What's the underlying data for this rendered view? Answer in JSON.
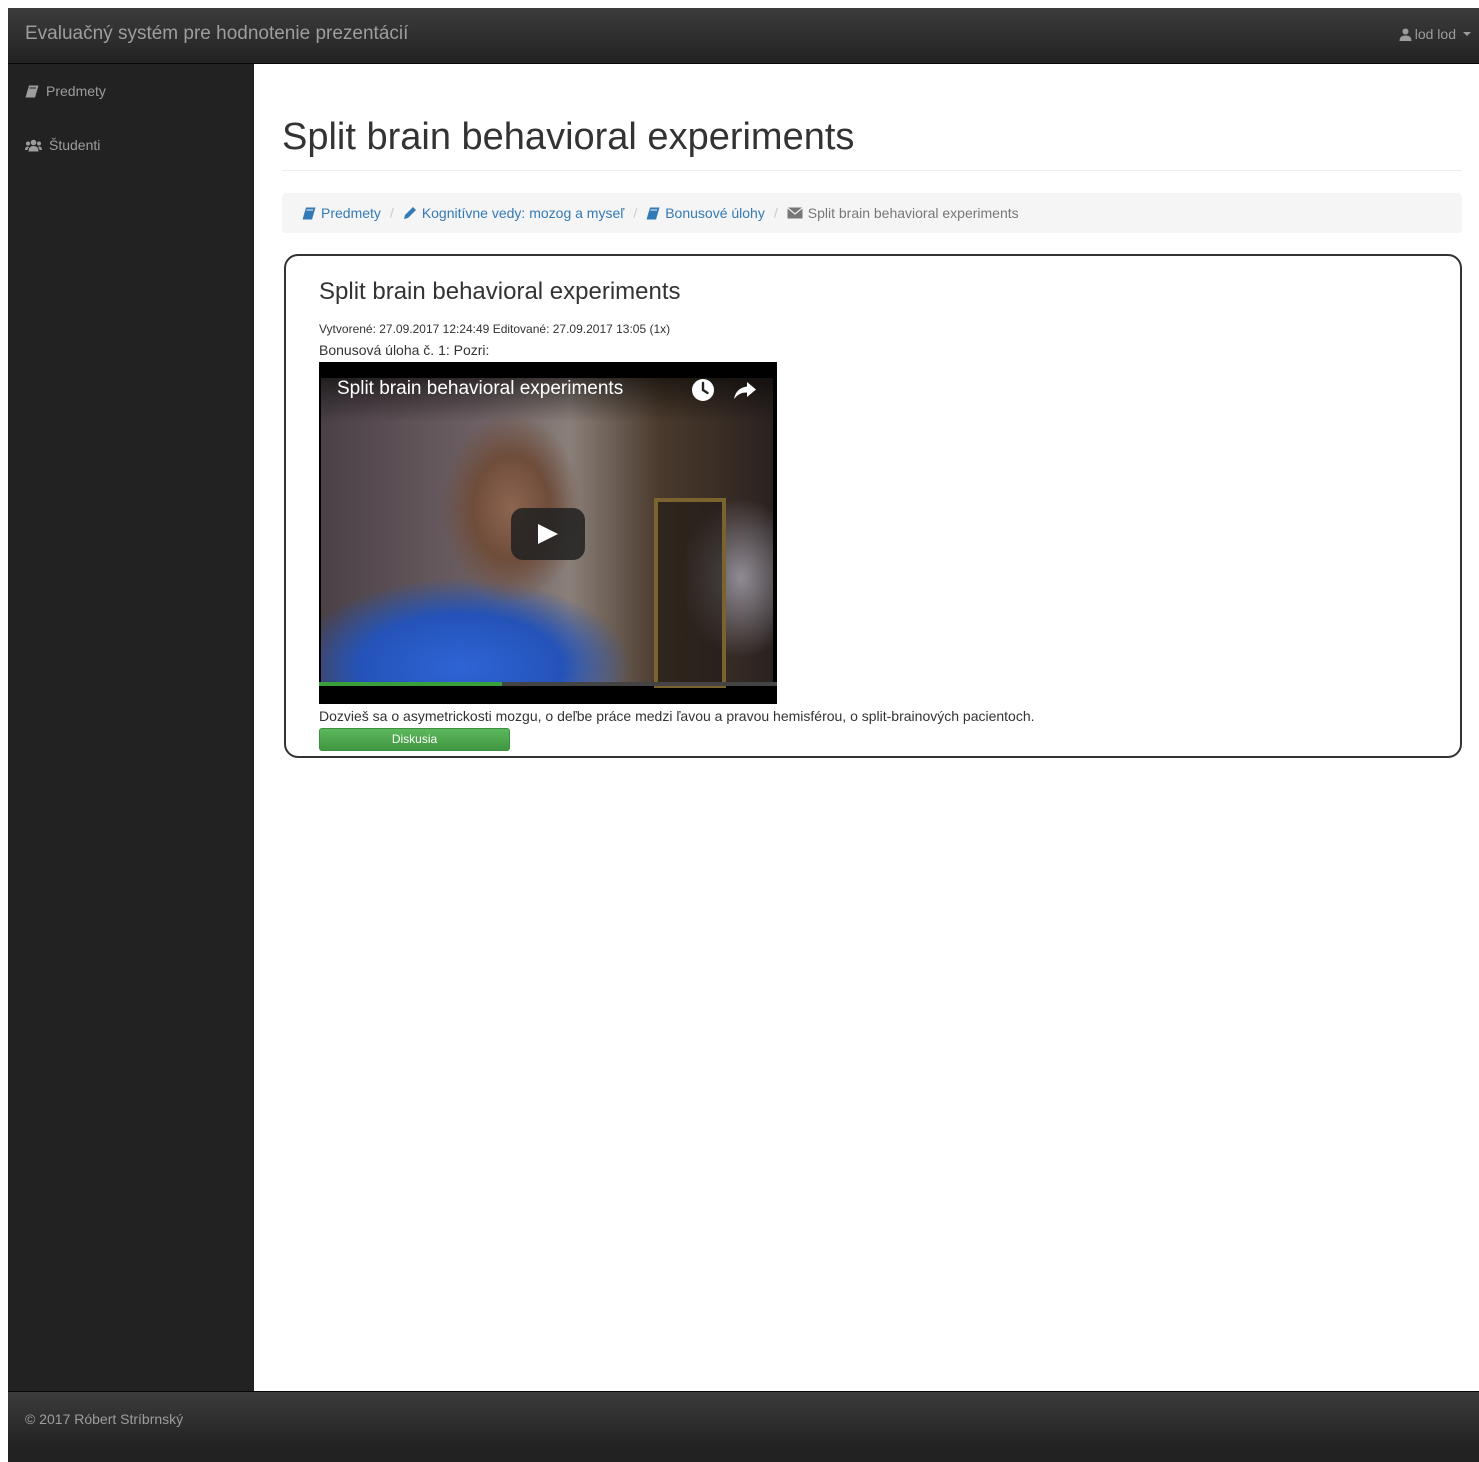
{
  "app": {
    "brand": "Evaluačný systém pre hodnotenie prezentácií",
    "user_label": "lod lod"
  },
  "sidebar": {
    "items": [
      {
        "label": "Predmety",
        "icon": "book-icon"
      },
      {
        "label": "Študenti",
        "icon": "users-icon"
      }
    ]
  },
  "page": {
    "title": "Split brain behavioral experiments"
  },
  "breadcrumb": {
    "items": [
      {
        "label": "Predmety",
        "icon": "book-icon"
      },
      {
        "label": "Kognitívne vedy: mozog a myseľ",
        "icon": "pencil-icon"
      },
      {
        "label": "Bonusové úlohy",
        "icon": "book-icon"
      },
      {
        "label": "Split brain behavioral experiments",
        "icon": "envelope-icon"
      }
    ]
  },
  "panel": {
    "title": "Split brain behavioral experiments",
    "meta": "Vytvorené: 27.09.2017 12:24:49 Editované: 27.09.2017 13:05 (1x)",
    "task": "Bonusová úloha č. 1: Pozri:",
    "video_title": "Split brain behavioral experiments",
    "description": "Dozvieš sa o asymetrickosti mozgu, o deľbe práce medzi ľavou a pravou hemisférou, o split-brainových pacientoch.",
    "button_label": "Diskusia"
  },
  "footer": {
    "text": "© 2017 Róbert Stríbrnský"
  },
  "colors": {
    "navbar": "#222222",
    "link": "#337ab7",
    "button": "#5cb85c"
  }
}
